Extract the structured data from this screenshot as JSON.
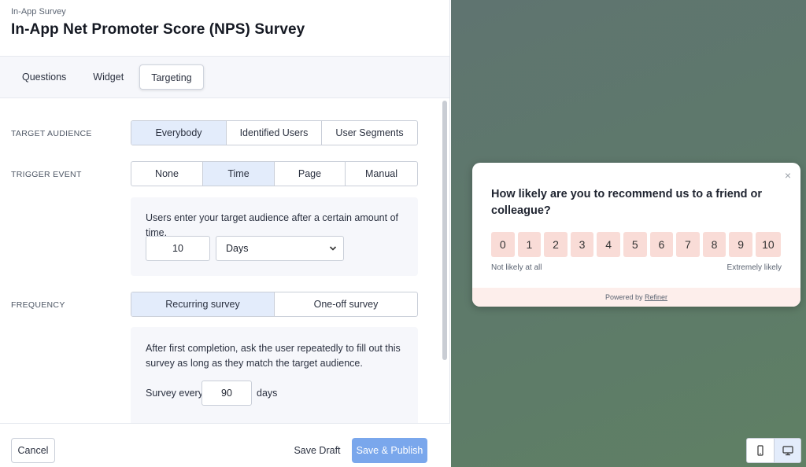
{
  "header": {
    "breadcrumb": "In-App Survey",
    "title": "In-App Net Promoter Score (NPS) Survey"
  },
  "tabs": [
    {
      "label": "Questions",
      "active": false
    },
    {
      "label": "Widget",
      "active": false
    },
    {
      "label": "Targeting",
      "active": true
    }
  ],
  "targeting": {
    "audience": {
      "label": "TARGET AUDIENCE",
      "options": [
        "Everybody",
        "Identified Users",
        "User Segments"
      ],
      "selected": "Everybody"
    },
    "trigger": {
      "label": "TRIGGER EVENT",
      "options": [
        "None",
        "Time",
        "Page",
        "Manual"
      ],
      "selected": "Time",
      "description": "Users enter your target audience after a certain amount of time.",
      "amount": "10",
      "unit": "Days"
    },
    "frequency": {
      "label": "FREQUENCY",
      "options": [
        "Recurring survey",
        "One-off survey"
      ],
      "selected": "Recurring survey",
      "description_line1": "After first completion, ask the user repeatedly to fill out this",
      "description_line2": "survey as long as they match the target audience.",
      "every_prefix": "Survey every",
      "every_value": "90",
      "every_suffix": "days"
    }
  },
  "footer": {
    "cancel": "Cancel",
    "save_draft": "Save Draft",
    "save_publish": "Save & Publish"
  },
  "preview": {
    "question_line1": "How likely are you to recommend us to a friend or",
    "question_line2": "colleague?",
    "scale": [
      "0",
      "1",
      "2",
      "3",
      "4",
      "5",
      "6",
      "7",
      "8",
      "9",
      "10"
    ],
    "low_label": "Not likely at all",
    "high_label": "Extremely likely",
    "powered_prefix": "Powered by",
    "powered_link": "Refiner",
    "close_icon": "×"
  },
  "colors": {
    "accent": "#7aa7ec",
    "selected_bg": "#e3ecfb",
    "score_bg": "#f9dcd7"
  }
}
